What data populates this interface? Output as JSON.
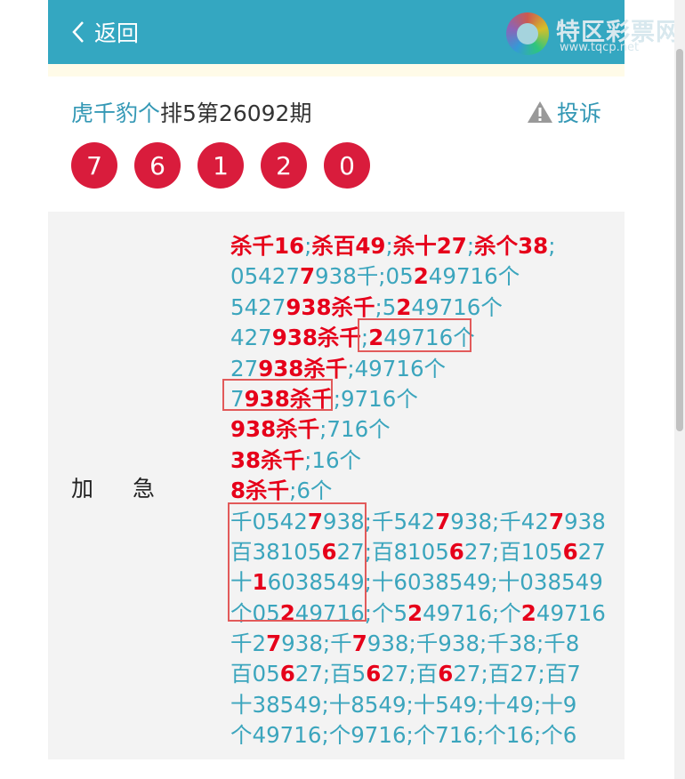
{
  "header": {
    "back_label": "返回",
    "logo_text": "特区彩票网",
    "logo_url": "www.tqcp.net"
  },
  "title": {
    "link": "虎千豹个",
    "rest": "排5第26092期"
  },
  "report_label": "投诉",
  "balls": [
    "7",
    "6",
    "1",
    "2",
    "0"
  ],
  "row_label": "加急",
  "lines": [
    [
      [
        "杀千16",
        1
      ],
      [
        ";",
        0
      ],
      [
        "杀百49",
        1
      ],
      [
        ";",
        0
      ],
      [
        "杀十27",
        1
      ],
      [
        ";",
        0
      ],
      [
        "杀个38",
        1
      ],
      [
        ";",
        0
      ]
    ],
    [
      [
        "05427",
        0
      ],
      [
        "7",
        1
      ],
      [
        "938千;05",
        0
      ],
      [
        "2",
        1
      ],
      [
        "49716个",
        0
      ]
    ],
    [
      [
        "5427",
        0
      ],
      [
        "938杀千",
        1
      ],
      [
        ";5",
        0
      ],
      [
        "2",
        1
      ],
      [
        "49716个",
        0
      ]
    ],
    [
      [
        "427",
        0
      ],
      [
        "938杀千",
        1
      ],
      [
        ";",
        0
      ],
      [
        "2",
        1
      ],
      [
        "49716个",
        0
      ]
    ],
    [
      [
        "27",
        0
      ],
      [
        "938杀千",
        1
      ],
      [
        ";49716个",
        0
      ]
    ],
    [
      [
        "7",
        0
      ],
      [
        "938杀千",
        1
      ],
      [
        ";9716个",
        0
      ]
    ],
    [
      [
        "938杀千",
        1
      ],
      [
        ";716个",
        0
      ]
    ],
    [
      [
        "38杀千",
        1
      ],
      [
        ";16个",
        0
      ]
    ],
    [
      [
        "8杀千",
        1
      ],
      [
        ";6个",
        0
      ]
    ],
    [
      [
        "千0542",
        0
      ],
      [
        "7",
        1
      ],
      [
        "938;千542",
        0
      ],
      [
        "7",
        1
      ],
      [
        "938;千42",
        0
      ],
      [
        "7",
        1
      ],
      [
        "938",
        0
      ]
    ],
    [
      [
        "百38105",
        0
      ],
      [
        "6",
        1
      ],
      [
        "27;百8105",
        0
      ],
      [
        "6",
        1
      ],
      [
        "27;百105",
        0
      ],
      [
        "6",
        1
      ],
      [
        "27",
        0
      ]
    ],
    [
      [
        "十",
        0
      ],
      [
        "1",
        1
      ],
      [
        "6038549;十6038549;十038549",
        0
      ]
    ],
    [
      [
        "个05",
        0
      ],
      [
        "2",
        1
      ],
      [
        "49716;个5",
        0
      ],
      [
        "2",
        1
      ],
      [
        "49716;个",
        0
      ],
      [
        "2",
        1
      ],
      [
        "49716",
        0
      ]
    ],
    [
      [
        "千2",
        0
      ],
      [
        "7",
        1
      ],
      [
        "938;千",
        0
      ],
      [
        "7",
        1
      ],
      [
        "938;千938;千38;千8",
        0
      ]
    ],
    [
      [
        "百05",
        0
      ],
      [
        "6",
        1
      ],
      [
        "27;百5",
        0
      ],
      [
        "6",
        1
      ],
      [
        "27;百",
        0
      ],
      [
        "6",
        1
      ],
      [
        "27;百27;百7",
        0
      ]
    ],
    [
      [
        "十38549;十8549;十549;十49;十9",
        0
      ]
    ],
    [
      [
        "个49716;个9716;个716;个16;个6",
        0
      ]
    ]
  ]
}
